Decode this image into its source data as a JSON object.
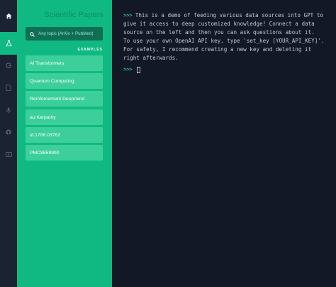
{
  "rail": {
    "items": [
      {
        "icon": "home-icon",
        "active": false
      },
      {
        "icon": "flask-icon",
        "active": true
      },
      {
        "icon": "google-icon",
        "active": false
      },
      {
        "icon": "document-icon",
        "active": false
      },
      {
        "icon": "microphone-icon",
        "active": false
      },
      {
        "icon": "github-icon",
        "active": false
      },
      {
        "icon": "youtube-icon",
        "active": false
      }
    ]
  },
  "panel": {
    "title": "Scientific Papers",
    "search_placeholder": "Any topic (ArXiv + PubMed)",
    "examples_label": "EXAMPLES",
    "examples": [
      "AI Transformers",
      "Quantum Computing",
      "Reinforcement Deepmind",
      "au:Karpathy",
      "id:1706.03762",
      "PMC8859990"
    ]
  },
  "terminal": {
    "prompt": ">>>",
    "intro": " This is a demo of feeding various data sources into GPT to give it access to deep customized knowledge! Connect a data source on the left and then you can ask questions about it.",
    "api_key_note": "To use your own OpenAI API key, type 'set_key [YOUR_API_KEY]'. For safety, I recommend creating a new key and deleting it right afterwards.",
    "input_value": ""
  },
  "colors": {
    "accent": "#10b981",
    "panel_button": "#3ccf9c",
    "terminal_bg": "#121826",
    "rail_bg": "#1b2231",
    "prompt": "#34d399"
  }
}
